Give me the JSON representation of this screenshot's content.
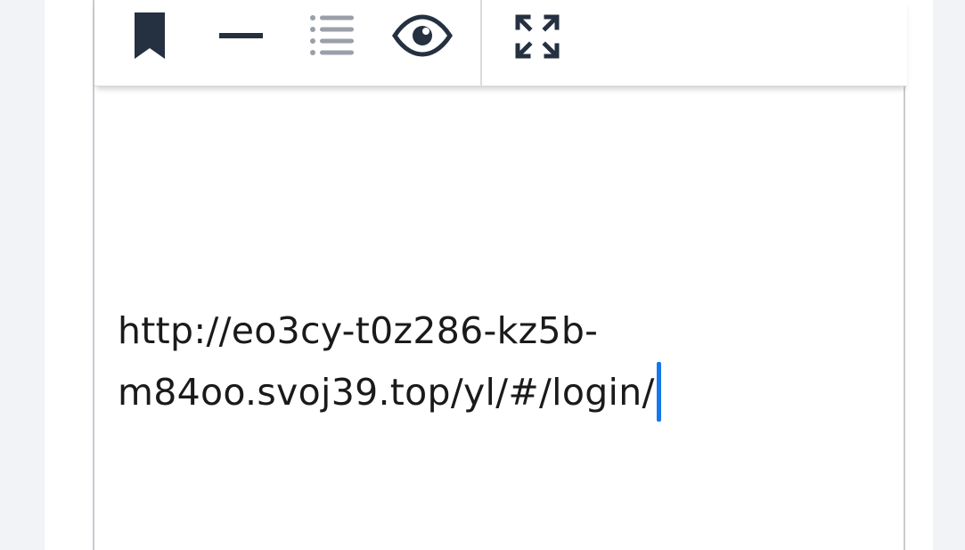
{
  "toolbar": {
    "items": [
      {
        "icon": "bookmark-icon"
      },
      {
        "icon": "horizontal-rule-icon"
      },
      {
        "icon": "list-icon"
      },
      {
        "icon": "eye-icon"
      },
      {
        "icon": "fullscreen-icon"
      }
    ],
    "icon_color": "#253041",
    "disabled_icon_color": "#9aa0a8"
  },
  "editor": {
    "lines": [
      "http://eo3cy-t0z286-kz5b-",
      "m84oo.svoj39.top/yl/#/login/"
    ],
    "caret_color": "#1677e8"
  }
}
